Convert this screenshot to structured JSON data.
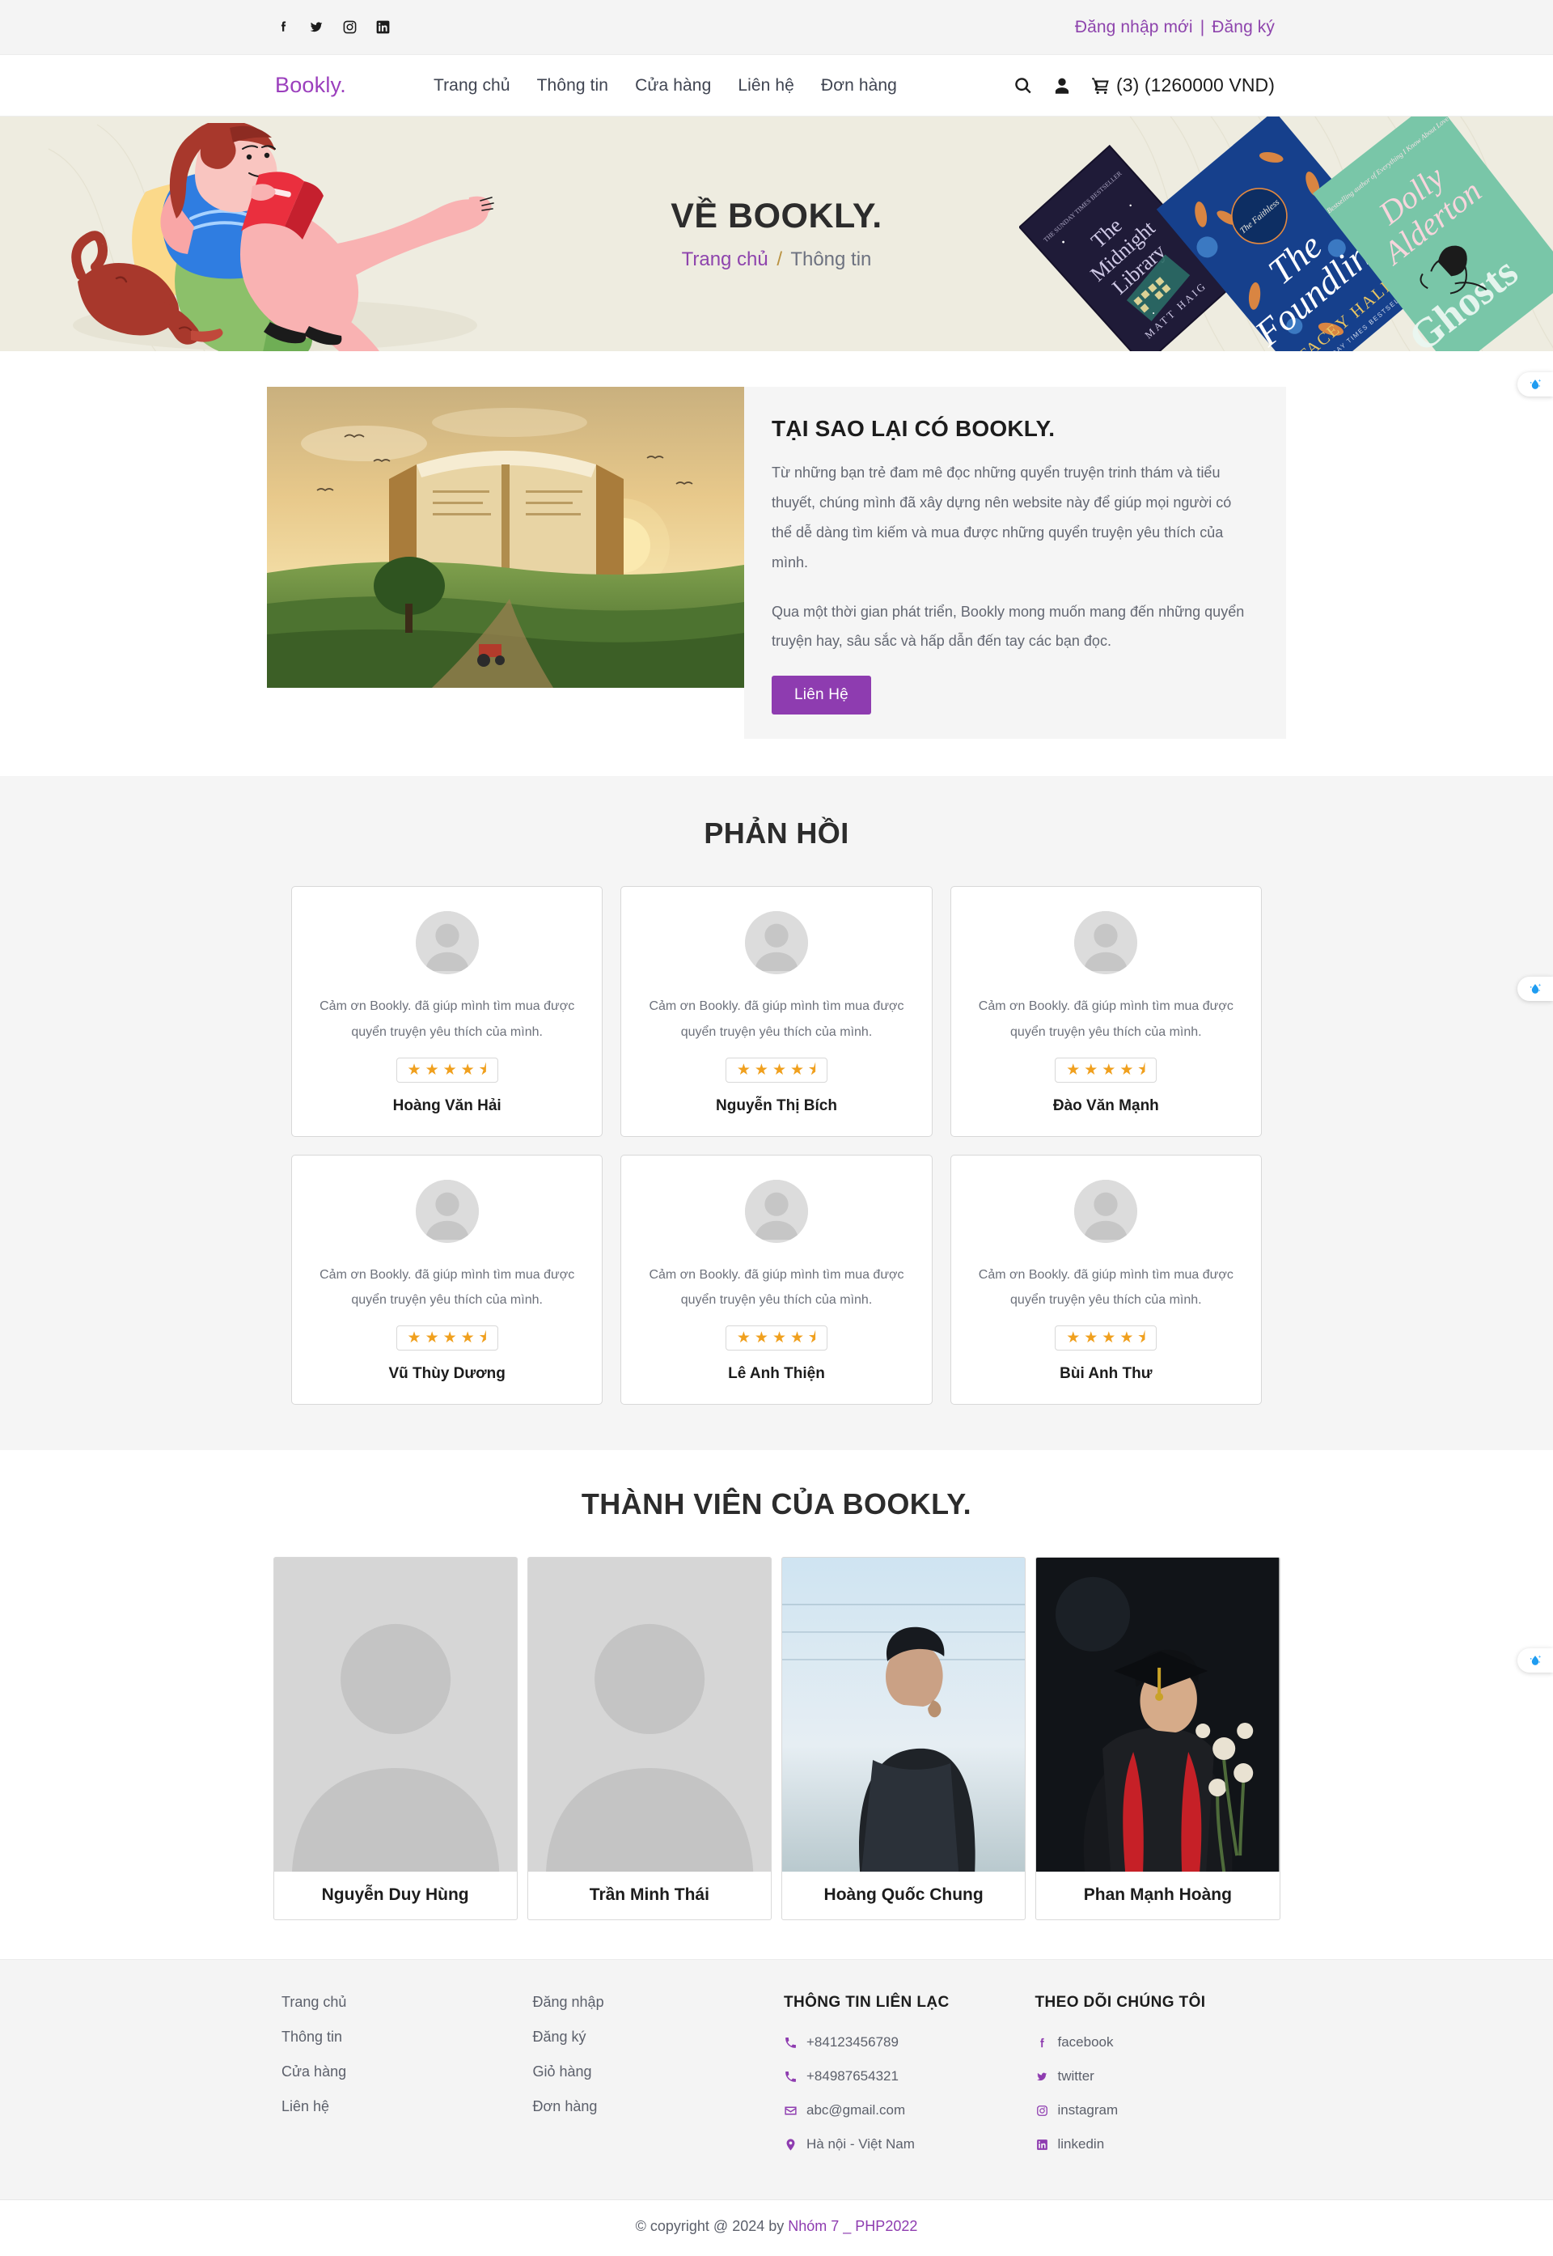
{
  "topbar": {
    "social": [
      {
        "name": "facebook-icon"
      },
      {
        "name": "twitter-icon"
      },
      {
        "name": "instagram-icon"
      },
      {
        "name": "linkedin-icon"
      }
    ],
    "login_label": "Đăng nhập mới",
    "separator": "|",
    "register_label": "Đăng ký",
    "link_color": "#8e44ad"
  },
  "header": {
    "brand": "Bookly.",
    "brand_color": "#9b3fbd",
    "nav": [
      {
        "label": "Trang chủ"
      },
      {
        "label": "Thông tin"
      },
      {
        "label": "Cửa hàng"
      },
      {
        "label": "Liên hệ"
      },
      {
        "label": "Đơn hàng"
      }
    ],
    "search_icon": "search-icon",
    "account_icon": "user-icon",
    "cart_icon": "cart-icon",
    "cart_text": "(3) (1260000 VND)"
  },
  "hero": {
    "title": "VỀ BOOKLY.",
    "crumb_home": "Trang chủ",
    "crumb_sep": "/",
    "crumb_current": "Thông tin",
    "bg_color": "#eeece0"
  },
  "why": {
    "heading": "TẠI SAO LẠI CÓ BOOKLY.",
    "paragraph1": "Từ những bạn trẻ đam mê đọc những quyển truyện trinh thám và tiểu thuyết, chúng mình đã xây dựng nên website này để giúp mọi người có thể dễ dàng tìm kiếm và mua được những quyển truyện yêu thích của mình.",
    "paragraph2": "Qua một thời gian phát triển, Bookly mong muốn mang đến những quyển truyện hay, sâu sắc và hấp dẫn đến tay các bạn đọc.",
    "button_label": "Liên Hệ",
    "button_color": "#8e3cb0"
  },
  "feedback": {
    "title": "PHẢN HỒI",
    "quote": "Cảm ơn Bookly. đã giúp mình tìm mua được quyển truyện yêu thích của mình.",
    "rating": "4.5",
    "star_color": "#f0a01e",
    "items": [
      {
        "name": "Hoàng Văn Hải"
      },
      {
        "name": "Nguyễn Thị Bích"
      },
      {
        "name": "Đào Văn Mạnh"
      },
      {
        "name": "Vũ Thùy Dương"
      },
      {
        "name": "Lê Anh Thiện"
      },
      {
        "name": "Bùi Anh Thư"
      }
    ]
  },
  "team": {
    "title": "THÀNH VIÊN CỦA BOOKLY.",
    "members": [
      {
        "name": "Nguyễn Duy Hùng",
        "photo": "placeholder"
      },
      {
        "name": "Trần Minh Thái",
        "photo": "placeholder"
      },
      {
        "name": "Hoàng Quốc Chung",
        "photo": "portrait-sky"
      },
      {
        "name": "Phan Mạnh Hoàng",
        "photo": "portrait-graduation"
      }
    ]
  },
  "footer": {
    "col1": [
      {
        "label": "Trang chủ"
      },
      {
        "label": "Thông tin"
      },
      {
        "label": "Cửa hàng"
      },
      {
        "label": "Liên hệ"
      }
    ],
    "col2": [
      {
        "label": "Đăng nhập"
      },
      {
        "label": "Đăng ký"
      },
      {
        "label": "Giỏ hàng"
      },
      {
        "label": "Đơn hàng"
      }
    ],
    "contact_head": "THÔNG TIN LIÊN LẠC",
    "contact": [
      {
        "icon": "phone-icon",
        "label": "+84123456789"
      },
      {
        "icon": "phone-icon",
        "label": "+84987654321"
      },
      {
        "icon": "mail-icon",
        "label": "abc@gmail.com"
      },
      {
        "icon": "location-pin-icon",
        "label": "Hà nội - Việt Nam"
      }
    ],
    "follow_head": "THEO DÕI CHÚNG TÔI",
    "follow": [
      {
        "icon": "facebook-icon",
        "label": "facebook"
      },
      {
        "icon": "twitter-icon",
        "label": "twitter"
      },
      {
        "icon": "instagram-icon",
        "label": "instagram"
      },
      {
        "icon": "linkedin-icon",
        "label": "linkedin"
      }
    ],
    "icon_color": "#8e3cb0"
  },
  "copyright": {
    "prefix": "© copyright @ 2024 by ",
    "accent": "Nhóm 7 _ PHP2022"
  },
  "float_widgets": {
    "icon": "water-drop-sparkle-icon",
    "count": 3
  }
}
